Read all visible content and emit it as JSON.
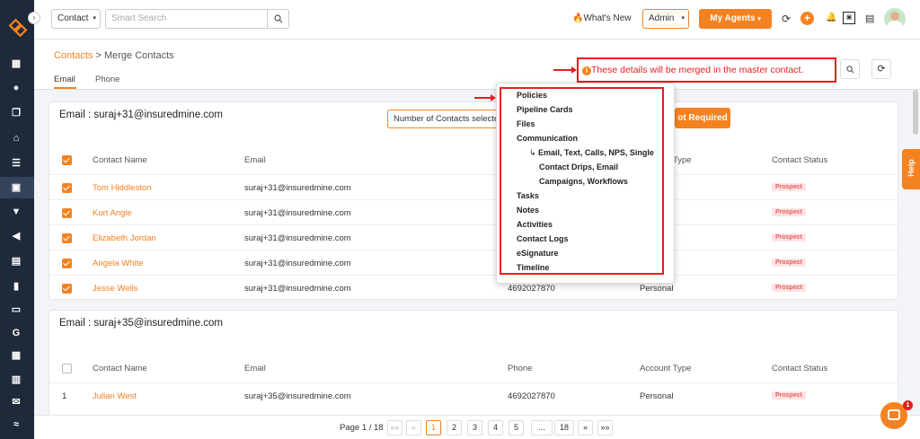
{
  "topbar": {
    "module_select": "Contact",
    "search_placeholder": "Smart Search",
    "whats_new": "What's New",
    "role_select": "Admin",
    "agents_button": "My Agents"
  },
  "breadcrumb": {
    "root": "Contacts",
    "separator": ">",
    "current": "Merge Contacts"
  },
  "tabs": [
    {
      "label": "Email"
    },
    {
      "label": "Phone"
    }
  ],
  "notice": "These details will be merged in the master contact.",
  "help_label": "Help",
  "groups": [
    {
      "title": "Email : suraj+31@insuredmine.com",
      "count_select": "Number of Contacts selecte",
      "action_button": "ot Required",
      "columns": [
        "Contact Name",
        "Email",
        "Phone",
        "Account Type",
        "Contact Status"
      ],
      "rows": [
        {
          "name": "Tom Hiddleston",
          "email": "suraj+31@insuredmine.com",
          "phone": "",
          "account": "",
          "status": "Prospect"
        },
        {
          "name": "Kurt Angle",
          "email": "suraj+31@insuredmine.com",
          "phone": "",
          "account": "",
          "status": "Prospect"
        },
        {
          "name": "Elizabeth Jordan",
          "email": "suraj+31@insuredmine.com",
          "phone": "",
          "account": "",
          "status": "Prospect"
        },
        {
          "name": "Angela White",
          "email": "suraj+31@insuredmine.com",
          "phone": "",
          "account": "",
          "status": "Prospect"
        },
        {
          "name": "Jesse Wells",
          "email": "suraj+31@insuredmine.com",
          "phone": "4692027870",
          "account": "Personal",
          "status": "Prospect"
        }
      ]
    },
    {
      "title": "Email : suraj+35@insuredmine.com",
      "columns": [
        "Contact Name",
        "Email",
        "Phone",
        "Account Type",
        "Contact Status"
      ],
      "rows": [
        {
          "index": "1",
          "name": "Julian West",
          "email": "suraj+35@insuredmine.com",
          "phone": "4692027870",
          "account": "Personal",
          "status": "Prospect"
        }
      ]
    }
  ],
  "hidden_account_header_fragment": "Type",
  "popover_items": [
    "Policies",
    "Pipeline Cards",
    "Files",
    "Communication",
    "Email, Text, Calls, NPS, Single",
    "Contact Drips, Email",
    "Campaigns, Workflows",
    "Tasks",
    "Notes",
    "Activities",
    "Contact Logs",
    "eSignature",
    "Timeline"
  ],
  "pagination": {
    "label": "Page 1 / 18",
    "first": "««",
    "prev": "«",
    "pages": [
      "1",
      "2",
      "3",
      "4",
      "5",
      "...",
      "18"
    ],
    "next": "»",
    "last": "»»"
  },
  "chat_badge": "1",
  "colors": {
    "accent": "#f58220",
    "sidebar": "#1e2a3a",
    "alert": "#e41e1e"
  }
}
